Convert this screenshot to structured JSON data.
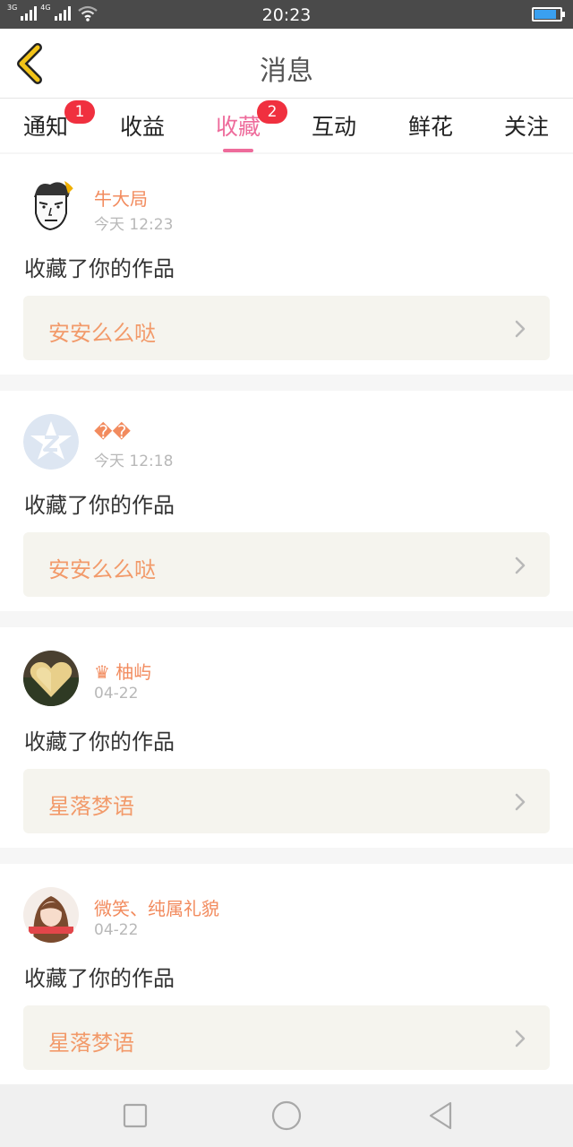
{
  "status_bar": {
    "net1": "3G",
    "net2": "4G",
    "time": "20:23",
    "battery_level": 0.85,
    "battery_color": "#3aa0f0"
  },
  "header": {
    "back_icon": "chevron-left-icon",
    "title": "消息"
  },
  "tabs": [
    {
      "label": "通知",
      "badge": "1",
      "active": false
    },
    {
      "label": "收益",
      "badge": "",
      "active": false
    },
    {
      "label": "收藏",
      "badge": "2",
      "active": true
    },
    {
      "label": "互动",
      "badge": "",
      "active": false
    },
    {
      "label": "鲜花",
      "badge": "",
      "active": false
    },
    {
      "label": "关注",
      "badge": "",
      "active": false
    }
  ],
  "colors": {
    "accent_pink": "#ee6b9b",
    "name_orange": "#f28b5e",
    "badge_red": "#f0303f",
    "back_yellow": "#f3c418"
  },
  "items": [
    {
      "username": "牛大局",
      "time": "今天 12:23",
      "message": "收藏了你的作品",
      "work": "安安么么哒",
      "avatar": "cartoon-face-avatar"
    },
    {
      "username": "��",
      "time": "今天 12:18",
      "message": "收藏了你的作品",
      "work": "安安么么哒",
      "avatar": "default-z-avatar"
    },
    {
      "username": "♛ 柚屿",
      "time": "04-22",
      "message": "收藏了你的作品",
      "work": "星落梦语",
      "avatar": "heart-photo-avatar"
    },
    {
      "username": "微笑、纯属礼貌",
      "time": "04-22",
      "message": "收藏了你的作品",
      "work": "星落梦语",
      "avatar": "girl-photo-avatar"
    }
  ],
  "nav_bar": {
    "recent_icon": "square-icon",
    "home_icon": "circle-icon",
    "back_icon": "triangle-back-icon"
  }
}
